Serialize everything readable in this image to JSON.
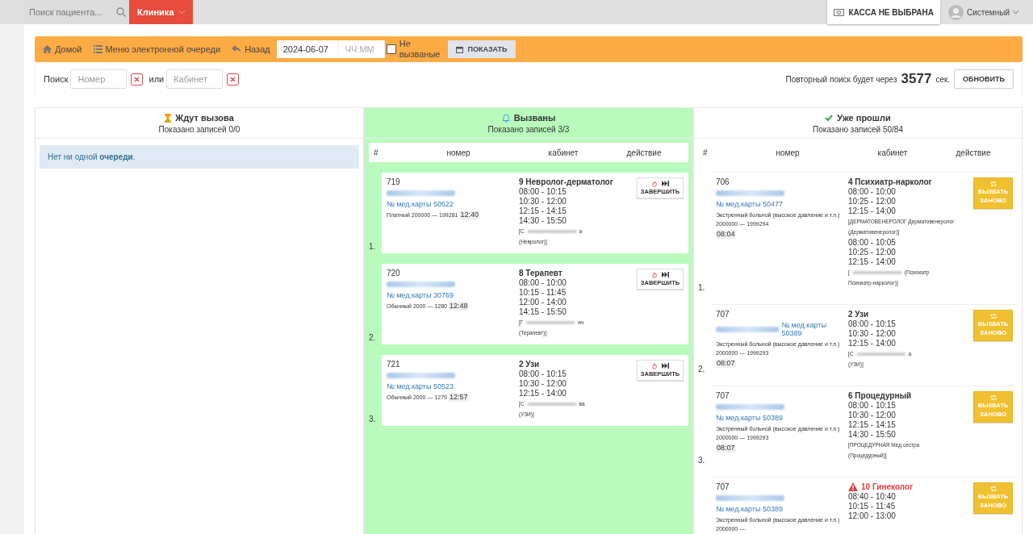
{
  "topbar": {
    "search": {
      "placeholder": "Поиск пациента..."
    },
    "clinic": "Клиника",
    "cashbox": "КАССА НЕ ВЫБРАНА",
    "user": "Системный"
  },
  "toolbar": {
    "links": [
      {
        "label": "Домой"
      },
      {
        "label": "Меню электронной очереди"
      },
      {
        "label": "Назад"
      }
    ],
    "date": "2024-06-07",
    "time": {
      "placeholder": "ЧЧ:ММ"
    },
    "not_called": {
      "label": "Не вызваные",
      "checked": false
    },
    "show_button": "ПОКАЗАТЬ"
  },
  "filter": {
    "label": "Поиск",
    "number": {
      "placeholder": "Номер"
    },
    "or": "или",
    "cabinet": {
      "placeholder": "Кабинет"
    },
    "refresh_text": "Повторный поиск будет через",
    "seconds": "3577",
    "unit": "сек.",
    "refresh_button": "ОБНОВИТЬ"
  },
  "columns": [
    {
      "kind": "waiting",
      "title": "Ждут вызова",
      "count": "Показано записей 0/0",
      "empty_message": "Нет ни одной **очереди**."
    },
    {
      "kind": "called",
      "title": "Вызваны",
      "count": "Показано записей 3/3",
      "headers": [
        "#",
        "номер",
        "кабинет",
        "действие"
      ],
      "rows": [
        {
          "index": "1.",
          "number": "719",
          "card": "№ мед.карты 50522",
          "card_inline": false,
          "meta": "Платный 200000 — 199281",
          "time": "12:40",
          "room": "9 Невролог-дерматолог",
          "warning": false,
          "blocks": [
            {
              "times": [
                "08:00 - 10:15",
                "10:30 - 12:00",
                "12:15 - 14:15",
                "14:30 - 15:50"
              ],
              "doctor": {
                "before": "[С",
                "blurred": true,
                "after": "а",
                "role": "(Невролог)]"
              }
            }
          ],
          "action": {
            "kind": "finish",
            "label": "ЗАВЕРШИТЬ"
          }
        },
        {
          "index": "2.",
          "number": "720",
          "card": "№ мед.карты 30769",
          "card_inline": false,
          "meta": "Обычный 2000 — 1280",
          "time": "12:48",
          "room": "8 Терапевт",
          "warning": false,
          "blocks": [
            {
              "times": [
                "08:00 - 10:00",
                "10:15 - 11:45",
                "12:00 - 14:00",
                "14:15 - 15:50"
              ],
              "doctor": {
                "before": "[Г",
                "blurred": true,
                "after": "ич",
                "role": "(Терапевт)]"
              }
            }
          ],
          "action": {
            "kind": "finish",
            "label": "ЗАВЕРШИТЬ"
          }
        },
        {
          "index": "3.",
          "number": "721",
          "card": "№ мед.карты 50523",
          "card_inline": false,
          "meta": "Обычный 2000 — 1279",
          "time": "12:57",
          "room": "2 Узи",
          "warning": false,
          "blocks": [
            {
              "times": [
                "08:00 - 10:15",
                "10:30 - 12:00",
                "12:15 - 14:00"
              ],
              "doctor": {
                "before": "[С",
                "blurred": true,
                "after": "ва",
                "role": "(УЗИ)]"
              }
            }
          ],
          "action": {
            "kind": "finish",
            "label": "ЗАВЕРШИТЬ"
          }
        }
      ]
    },
    {
      "kind": "done",
      "title": "Уже прошли",
      "count": "Показано записей 50/84",
      "headers": [
        "#",
        "номер",
        "кабинет",
        "действие"
      ],
      "rows": [
        {
          "index": "1.",
          "number": "706",
          "card": "№ мед.карты 50477",
          "card_inline": false,
          "meta": "Экстренный больной (высокое давление и т.п.) 2000000 — 1999294",
          "time": "08:04",
          "room": "4 Психиатр-нарколог",
          "warning": false,
          "blocks": [
            {
              "times": [
                "08:00 - 10:00",
                "10:25 - 12:00",
                "12:15 - 14:00"
              ],
              "doctor": {
                "before": "[ДЕРМАТОВЕНЕРОЛОГ Дерматовенеролог",
                "blurred": false,
                "role": "(Дерматовенеролог)]"
              }
            },
            {
              "times": [
                "08:00 - 10:05",
                "10:25 - 12:00",
                "12:15 - 14:00"
              ],
              "doctor": {
                "before": "[",
                "blurred": true,
                "after": "(Психиатр",
                "role": "Психиатр-нарколог)]"
              }
            }
          ],
          "action": {
            "kind": "recall",
            "label": "ВЫЗВАТЬ ЗАНОВО"
          }
        },
        {
          "index": "2.",
          "number": "707",
          "card": "№ мед.карты 50389",
          "card_inline": true,
          "meta": "Экстренный больной (высокое давление и т.п.) 2000000 — 1999293",
          "time": "08:07",
          "room": "2 Узи",
          "warning": false,
          "blocks": [
            {
              "times": [
                "08:00 - 10:15",
                "10:30 - 12:00",
                "12:15 - 14:00"
              ],
              "doctor": {
                "before": "[С",
                "blurred": true,
                "after": "а",
                "role": "(УЗИ)]"
              }
            }
          ],
          "action": {
            "kind": "recall",
            "label": "ВЫЗВАТЬ ЗАНОВО"
          }
        },
        {
          "index": "3.",
          "number": "707",
          "card": "№ мед.карты 50389",
          "card_inline": false,
          "meta": "Экстренный больной (высокое давление и т.п.) 2000000 — 1999293",
          "time": "08:07",
          "room": "6 Процедурный",
          "warning": false,
          "blocks": [
            {
              "times": [
                "08:00 - 10:15",
                "10:30 - 12:00",
                "12:15 - 14:15",
                "14:30 - 15:50"
              ],
              "doctor": {
                "before": "[ПРОЦЕДУРНАЯ Мед сестра",
                "blurred": false,
                "role": "(Процедурный)]"
              }
            }
          ],
          "action": {
            "kind": "recall",
            "label": "ВЫЗВАТЬ ЗАНОВО"
          }
        },
        {
          "number": "707",
          "card": "№ мед.карты 50389",
          "card_inline": false,
          "meta": "Экстренный больной (высокое давление и т.п.) 2000000 —",
          "room": "10 Гинеколог",
          "warning": true,
          "blocks": [
            {
              "times": [
                "08:40 - 10:40",
                "10:15 - 11:45",
                "12:00 - 13:00"
              ]
            }
          ],
          "action": {
            "kind": "recall",
            "label": "ВЫЗВАТЬ ЗАНОВО"
          }
        }
      ]
    }
  ]
}
